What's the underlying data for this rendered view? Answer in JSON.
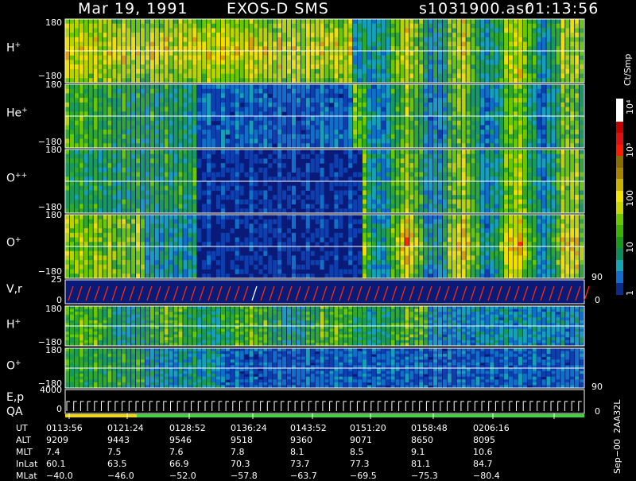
{
  "header": {
    "date": "Mar 19, 1991",
    "instrument": "EXOS-D SMS",
    "file": "s1031900.asr",
    "time": "01:13:56"
  },
  "panels": {
    "h_plus": {
      "base": "H",
      "sup": "+",
      "ymax": "180",
      "ymin": "−180"
    },
    "he_plus": {
      "base": "He",
      "sup": "+",
      "ymax": "180",
      "ymin": "−180"
    },
    "o_pp": {
      "base": "O",
      "sup": "++",
      "ymax": "180",
      "ymin": "−180"
    },
    "o_plus": {
      "base": "O",
      "sup": "+",
      "ymax": "180",
      "ymin": "−180"
    },
    "vr": {
      "label": "V,r",
      "ymax": "25",
      "ymin": "0",
      "right_top": "90",
      "right_bottom": "0"
    },
    "h_plus2": {
      "base": "H",
      "sup": "+",
      "ymax": "180",
      "ymin": "−180"
    },
    "o_plus2": {
      "base": "O",
      "sup": "+",
      "ymax": "180",
      "ymin": "−180",
      "right_bottom": "90"
    },
    "ep": {
      "label": "E,p",
      "ymax": "4000",
      "ymin": "0",
      "right_bottom": "0"
    },
    "qa": {
      "label": "QA"
    }
  },
  "colorbar": {
    "unit": "Ct/Smp",
    "labels": [
      "10⁴",
      "10³",
      "100",
      "10",
      "1"
    ],
    "colors": [
      "#ffffff",
      "#ffffff",
      "#c40000",
      "#e01010",
      "#ff1a00",
      "#8a6d00",
      "#a88400",
      "#c8b400",
      "#f5e600",
      "#c8d800",
      "#6ac800",
      "#3ab400",
      "#1a9a1a",
      "#0f8a5a",
      "#14a6b4",
      "#0f6ecf",
      "#0a2a8c"
    ]
  },
  "footer": {
    "side": "Sep−00  2AA32L",
    "rows": [
      {
        "label": "UT",
        "values": [
          "0113:56",
          "0121:24",
          "0128:52",
          "0136:24",
          "0143:52",
          "0151:20",
          "0158:48",
          "0206:16"
        ]
      },
      {
        "label": "ALT",
        "values": [
          "9209",
          "9443",
          "9546",
          "9518",
          "9360",
          "9071",
          "8650",
          "8095"
        ]
      },
      {
        "label": "MLT",
        "values": [
          "7.4",
          "7.5",
          "7.6",
          "7.8",
          "8.1",
          "8.5",
          "9.1",
          "10.6"
        ]
      },
      {
        "label": "InLat",
        "values": [
          "60.1",
          "63.5",
          "66.9",
          "70.3",
          "73.7",
          "77.3",
          "81.1",
          "84.7"
        ]
      },
      {
        "label": "MLat",
        "values": [
          "−40.0",
          "−46.0",
          "−52.0",
          "−57.8",
          "−63.7",
          "−69.5",
          "−75.3",
          "−80.4"
        ]
      }
    ]
  },
  "chart_data": {
    "type": "heatmap",
    "x_label": "UT",
    "x_ticks": [
      "0113:56",
      "0121:24",
      "0128:52",
      "0136:24",
      "0143:52",
      "0151:20",
      "0158:48",
      "0206:16"
    ],
    "panels": [
      {
        "name": "H+",
        "y_range": [
          -180,
          180
        ]
      },
      {
        "name": "He+",
        "y_range": [
          -180,
          180
        ]
      },
      {
        "name": "O++",
        "y_range": [
          -180,
          180
        ]
      },
      {
        "name": "O+",
        "y_range": [
          -180,
          180
        ]
      },
      {
        "name": "V,r",
        "y_range": [
          0,
          25
        ],
        "right_axis": [
          0,
          90
        ]
      },
      {
        "name": "H+",
        "y_range": [
          -180,
          180
        ]
      },
      {
        "name": "O+",
        "y_range": [
          -180,
          180
        ],
        "right_axis": [
          90
        ]
      },
      {
        "name": "E,p",
        "y_range": [
          0,
          4000
        ],
        "right_axis": [
          0
        ]
      },
      {
        "name": "QA"
      }
    ],
    "color_scale": {
      "unit": "Ct/Smp",
      "ticks": [
        "1",
        "10",
        "100",
        "10³",
        "10⁴"
      ],
      "log": true
    }
  }
}
